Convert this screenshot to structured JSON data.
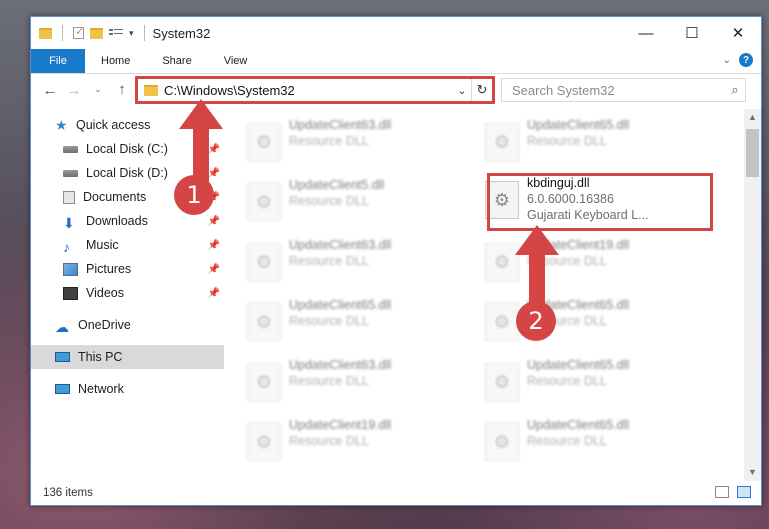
{
  "window": {
    "title": "System32",
    "buttons": [
      "—",
      "☐",
      "✕"
    ]
  },
  "ribbon": {
    "file": "File",
    "tabs": [
      "Home",
      "Share",
      "View"
    ],
    "help": "?"
  },
  "address": {
    "path": "C:\\Windows\\System32",
    "refresh": "↻"
  },
  "search": {
    "placeholder": "Search System32"
  },
  "sidebar": {
    "items": [
      {
        "label": "Quick access",
        "pinned": false
      },
      {
        "label": "Local Disk (C:)",
        "pinned": true
      },
      {
        "label": "Local Disk (D:)",
        "pinned": true
      },
      {
        "label": "Documents",
        "pinned": true
      },
      {
        "label": "Downloads",
        "pinned": true
      },
      {
        "label": "Music",
        "pinned": true
      },
      {
        "label": "Pictures",
        "pinned": true
      },
      {
        "label": "Videos",
        "pinned": true
      },
      {
        "label": "OneDrive",
        "pinned": false
      },
      {
        "label": "This PC",
        "pinned": false
      },
      {
        "label": "Network",
        "pinned": false
      }
    ]
  },
  "files": {
    "left": [
      {
        "name": "UpdateClient63.dll",
        "sub": "Resource DLL"
      },
      {
        "name": "UpdateClient5.dll",
        "sub": "Resource DLL"
      },
      {
        "name": "UpdateClient63.dll",
        "sub": "Resource DLL"
      },
      {
        "name": "UpdateClient65.dll",
        "sub": "Resource DLL"
      },
      {
        "name": "UpdateClient63.dll",
        "sub": "Resource DLL"
      },
      {
        "name": "UpdateClient19.dll",
        "sub": "Resource DLL"
      }
    ],
    "right": [
      {
        "name": "UpdateClient65.dll",
        "sub": "Resource DLL"
      },
      {
        "name": "kbdinguj.dll",
        "sub": "6.0.6000.16386",
        "sub2": "Gujarati Keyboard L..."
      },
      {
        "name": "UpdateClient19.dll",
        "sub": "Resource DLL"
      },
      {
        "name": "UpdateClient65.dll",
        "sub": "Resource DLL"
      },
      {
        "name": "UpdateClient65.dll",
        "sub": "Resource DLL"
      },
      {
        "name": "UpdateClient65.dll",
        "sub": "Resource DLL"
      }
    ]
  },
  "status": {
    "count": "136 items"
  },
  "annotations": {
    "one": "1",
    "two": "2",
    "color": "#d64545"
  }
}
